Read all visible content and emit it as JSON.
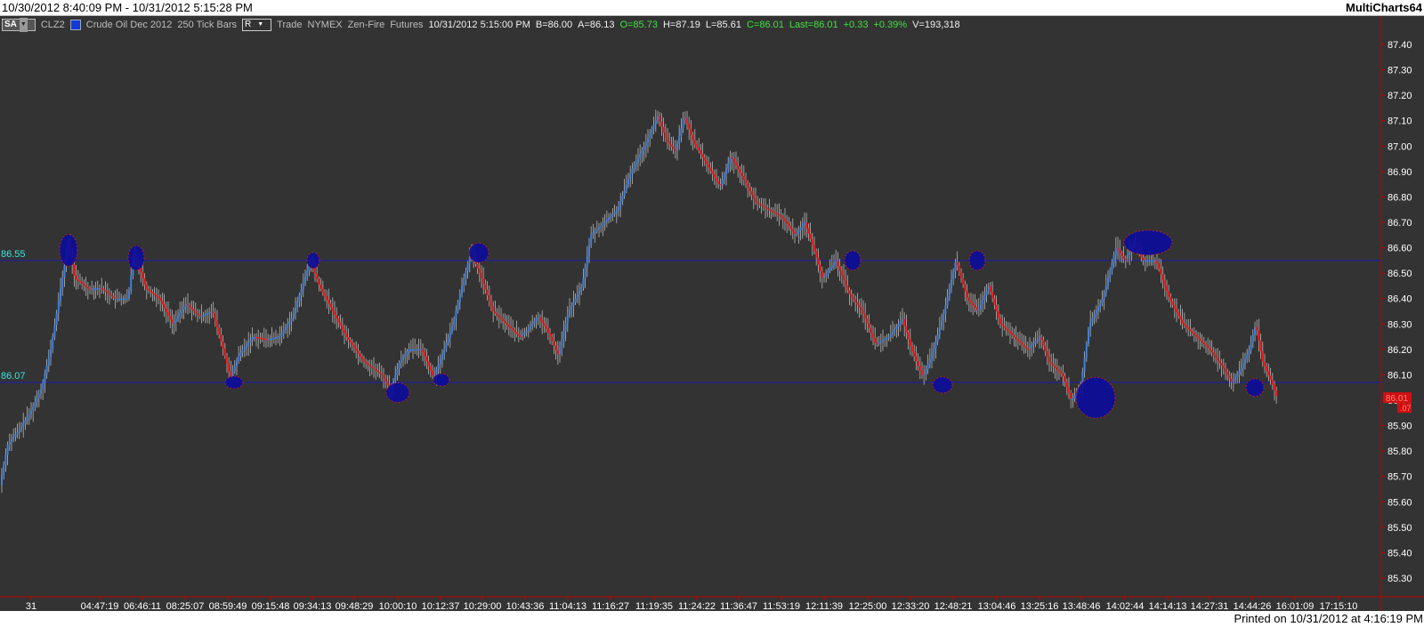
{
  "window": {
    "title": "10/30/2012 8:40:09 PM - 10/31/2012 5:15:28 PM",
    "app": "MultiCharts64"
  },
  "info_bar": {
    "sa_label": "SA",
    "symbol": "CLZ2",
    "description": "Crude Oil Dec 2012",
    "resolution": "250 Tick Bars",
    "r_label": "R",
    "data_type": "Trade",
    "exchange": "NYMEX",
    "feed": "Zen-Fire",
    "category": "Futures",
    "datetime": "10/31/2012  5:15:00 PM",
    "bid": "B=86.00",
    "ask": "A=86.13",
    "open": "O=85.73",
    "high": "H=87.19",
    "low": "L=85.61",
    "close": "C=86.01",
    "last": "Last=86.01",
    "change": "+0.33",
    "change_pct": "+0.39%",
    "volume": "V=193,318"
  },
  "colors": {
    "background": "#333333",
    "up_bar": "#3d7fe0",
    "down_bar": "#ff1a1a",
    "wick": "#b8b8b8",
    "level_line": "#1b1bb0",
    "marker": "#0c0c9a",
    "level_label": "#35e6e6",
    "axis_text": "#ffffff",
    "axis_line": "#c00000"
  },
  "chart_data": {
    "type": "candlestick",
    "y_ticks": [
      "87.40",
      "87.30",
      "87.20",
      "87.10",
      "87.00",
      "86.90",
      "86.80",
      "86.70",
      "86.60",
      "86.50",
      "86.40",
      "86.30",
      "86.20",
      "86.10",
      "86.00",
      "85.90",
      "85.80",
      "85.70",
      "85.60",
      "85.50",
      "85.40",
      "85.30"
    ],
    "ylim": [
      85.27,
      87.5
    ],
    "x_ticks": [
      "31",
      "04:47:19",
      "06:46:11",
      "08:25:07",
      "08:59:49",
      "09:15:48",
      "09:34:13",
      "09:48:29",
      "10:00:10",
      "10:12:37",
      "10:29:00",
      "10:43:36",
      "11:04:13",
      "11:16:27",
      "11:19:35",
      "11:24:22",
      "11:36:47",
      "11:53:19",
      "12:11:39",
      "12:25:00",
      "12:33:20",
      "12:48:21",
      "13:04:46",
      "13:25:16",
      "13:48:46",
      "14:02:44",
      "14:14:13",
      "14:27:31",
      "14:44:26",
      "16:01:09",
      "17:15:10"
    ],
    "horizontal_levels": [
      {
        "label": "86.55",
        "value": 86.55
      },
      {
        "label": "86.07",
        "value": 86.07
      }
    ],
    "last_price_label": "86.01",
    "last_price_sub": ".07",
    "price_path": [
      [
        0,
        85.65
      ],
      [
        10,
        85.83
      ],
      [
        22,
        85.88
      ],
      [
        35,
        85.95
      ],
      [
        48,
        86.05
      ],
      [
        58,
        86.2
      ],
      [
        72,
        86.5
      ],
      [
        78,
        86.62
      ],
      [
        85,
        86.48
      ],
      [
        100,
        86.44
      ],
      [
        115,
        86.44
      ],
      [
        130,
        86.4
      ],
      [
        145,
        86.4
      ],
      [
        152,
        86.59
      ],
      [
        165,
        86.44
      ],
      [
        180,
        86.4
      ],
      [
        195,
        86.3
      ],
      [
        210,
        86.38
      ],
      [
        225,
        86.33
      ],
      [
        240,
        86.35
      ],
      [
        252,
        86.2
      ],
      [
        260,
        86.09
      ],
      [
        270,
        86.18
      ],
      [
        285,
        86.25
      ],
      [
        300,
        86.24
      ],
      [
        315,
        86.25
      ],
      [
        330,
        86.33
      ],
      [
        350,
        86.55
      ],
      [
        360,
        86.45
      ],
      [
        375,
        86.35
      ],
      [
        390,
        86.25
      ],
      [
        410,
        86.15
      ],
      [
        430,
        86.1
      ],
      [
        440,
        86.04
      ],
      [
        450,
        86.15
      ],
      [
        460,
        86.2
      ],
      [
        475,
        86.2
      ],
      [
        488,
        86.09
      ],
      [
        500,
        86.2
      ],
      [
        510,
        86.3
      ],
      [
        520,
        86.45
      ],
      [
        530,
        86.58
      ],
      [
        540,
        86.5
      ],
      [
        555,
        86.35
      ],
      [
        570,
        86.3
      ],
      [
        585,
        86.25
      ],
      [
        595,
        86.28
      ],
      [
        605,
        86.33
      ],
      [
        615,
        86.28
      ],
      [
        628,
        86.18
      ],
      [
        640,
        86.35
      ],
      [
        655,
        86.45
      ],
      [
        665,
        86.65
      ],
      [
        680,
        86.7
      ],
      [
        695,
        86.75
      ],
      [
        710,
        86.9
      ],
      [
        725,
        87.0
      ],
      [
        740,
        87.12
      ],
      [
        750,
        87.02
      ],
      [
        760,
        86.98
      ],
      [
        770,
        87.12
      ],
      [
        780,
        87.02
      ],
      [
        790,
        86.96
      ],
      [
        800,
        86.9
      ],
      [
        810,
        86.84
      ],
      [
        822,
        86.96
      ],
      [
        835,
        86.88
      ],
      [
        850,
        86.78
      ],
      [
        865,
        86.75
      ],
      [
        880,
        86.72
      ],
      [
        895,
        86.65
      ],
      [
        905,
        86.7
      ],
      [
        915,
        86.6
      ],
      [
        925,
        86.48
      ],
      [
        940,
        86.55
      ],
      [
        955,
        86.42
      ],
      [
        970,
        86.35
      ],
      [
        985,
        86.22
      ],
      [
        1000,
        86.25
      ],
      [
        1015,
        86.32
      ],
      [
        1025,
        86.2
      ],
      [
        1038,
        86.09
      ],
      [
        1050,
        86.2
      ],
      [
        1062,
        86.35
      ],
      [
        1075,
        86.55
      ],
      [
        1088,
        86.4
      ],
      [
        1100,
        86.35
      ],
      [
        1112,
        86.45
      ],
      [
        1125,
        86.3
      ],
      [
        1140,
        86.25
      ],
      [
        1155,
        86.2
      ],
      [
        1170,
        86.25
      ],
      [
        1180,
        86.15
      ],
      [
        1195,
        86.1
      ],
      [
        1205,
        86.0
      ],
      [
        1215,
        86.05
      ],
      [
        1225,
        86.3
      ],
      [
        1240,
        86.4
      ],
      [
        1255,
        86.6
      ],
      [
        1265,
        86.55
      ],
      [
        1275,
        86.62
      ],
      [
        1285,
        86.55
      ],
      [
        1300,
        86.55
      ],
      [
        1315,
        86.4
      ],
      [
        1330,
        86.3
      ],
      [
        1345,
        86.25
      ],
      [
        1360,
        86.2
      ],
      [
        1375,
        86.13
      ],
      [
        1385,
        86.07
      ],
      [
        1395,
        86.12
      ],
      [
        1405,
        86.2
      ],
      [
        1412,
        86.3
      ],
      [
        1420,
        86.15
      ],
      [
        1430,
        86.07
      ],
      [
        1436,
        86.01
      ]
    ],
    "markers": [
      {
        "x": 77,
        "price": 86.59,
        "rx": 10,
        "ry": 18
      },
      {
        "x": 153,
        "price": 86.56,
        "rx": 9,
        "ry": 14
      },
      {
        "x": 352,
        "price": 86.55,
        "rx": 7,
        "ry": 9
      },
      {
        "x": 538,
        "price": 86.58,
        "rx": 11,
        "ry": 11
      },
      {
        "x": 958,
        "price": 86.55,
        "rx": 9,
        "ry": 11
      },
      {
        "x": 1098,
        "price": 86.55,
        "rx": 9,
        "ry": 11
      },
      {
        "x": 1290,
        "price": 86.62,
        "rx": 27,
        "ry": 14
      },
      {
        "x": 263,
        "price": 86.07,
        "rx": 10,
        "ry": 7
      },
      {
        "x": 447,
        "price": 86.03,
        "rx": 13,
        "ry": 11
      },
      {
        "x": 496,
        "price": 86.08,
        "rx": 9,
        "ry": 7
      },
      {
        "x": 1059,
        "price": 86.06,
        "rx": 11,
        "ry": 9
      },
      {
        "x": 1231,
        "price": 86.01,
        "rx": 22,
        "ry": 23
      },
      {
        "x": 1410,
        "price": 86.05,
        "rx": 10,
        "ry": 10
      }
    ]
  },
  "footer": {
    "printed": "Printed on 10/31/2012 at 4:16:19 PM"
  }
}
